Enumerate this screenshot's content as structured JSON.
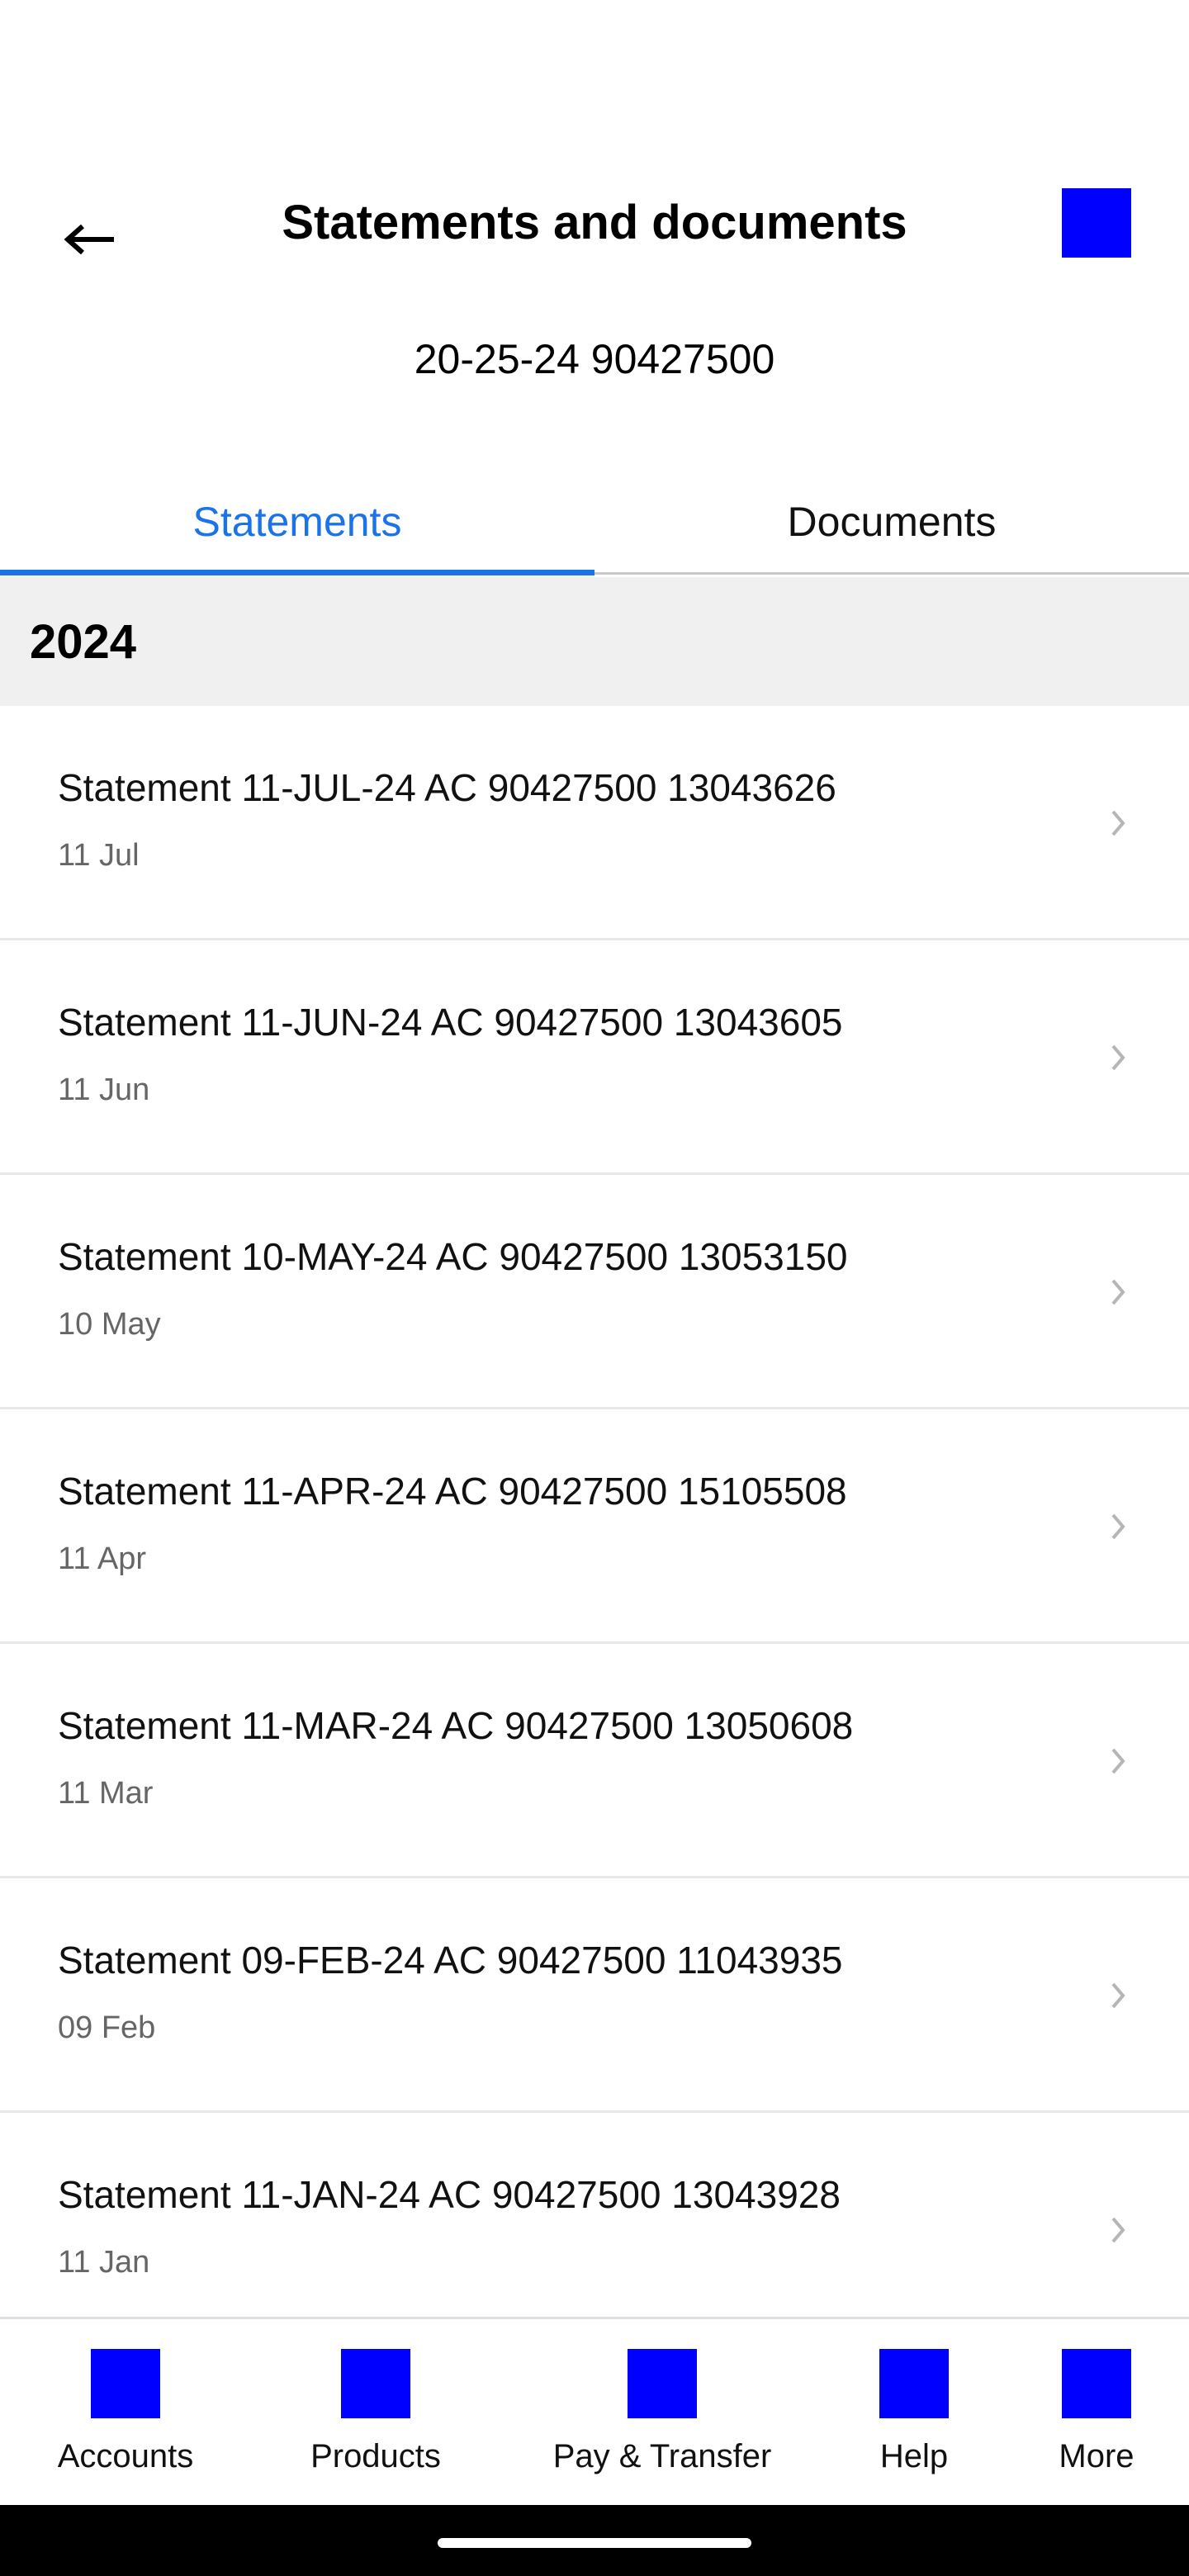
{
  "header": {
    "title": "Statements and documents",
    "back_icon": "arrow-left-icon",
    "action_color": "#0000ff"
  },
  "account": {
    "number": "20-25-24 90427500"
  },
  "tabs": [
    {
      "label": "Statements",
      "active": true
    },
    {
      "label": "Documents",
      "active": false
    }
  ],
  "section": {
    "year": "2024"
  },
  "statements": [
    {
      "title": "Statement 11-JUL-24 AC 90427500 13043626",
      "date": "11 Jul"
    },
    {
      "title": "Statement 11-JUN-24 AC 90427500 13043605",
      "date": "11 Jun"
    },
    {
      "title": "Statement 10-MAY-24 AC 90427500 13053150",
      "date": "10 May"
    },
    {
      "title": "Statement 11-APR-24 AC 90427500 15105508",
      "date": "11 Apr"
    },
    {
      "title": "Statement 11-MAR-24 AC 90427500 13050608",
      "date": "11 Mar"
    },
    {
      "title": "Statement 09-FEB-24 AC 90427500 11043935",
      "date": "09 Feb"
    },
    {
      "title": "Statement 11-JAN-24 AC 90427500 13043928",
      "date": "11 Jan"
    }
  ],
  "bottom_nav": [
    {
      "label": "Accounts"
    },
    {
      "label": "Products"
    },
    {
      "label": "Pay & Transfer"
    },
    {
      "label": "Help"
    },
    {
      "label": "More"
    }
  ],
  "colors": {
    "accent": "#1a73e8",
    "placeholder_icon": "#0000ff",
    "section_bg": "#f0f0f0"
  }
}
